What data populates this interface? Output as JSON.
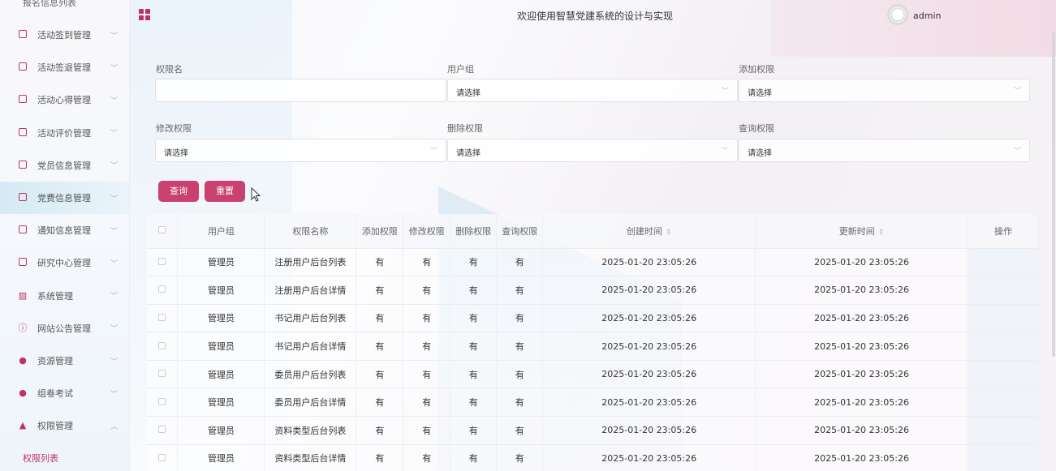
{
  "sidebar": {
    "top_label": "报名信息列表",
    "items": [
      {
        "label": "活动签到管理",
        "icon": "page-icon"
      },
      {
        "label": "活动签退管理",
        "icon": "page-icon"
      },
      {
        "label": "活动心得管理",
        "icon": "page-icon"
      },
      {
        "label": "活动评价管理",
        "icon": "page-icon"
      },
      {
        "label": "党员信息管理",
        "icon": "page-icon"
      },
      {
        "label": "党费信息管理",
        "icon": "page-icon"
      },
      {
        "label": "通知信息管理",
        "icon": "page-icon"
      },
      {
        "label": "研究中心管理",
        "icon": "page-icon"
      },
      {
        "label": "系统管理",
        "icon": "image-icon"
      },
      {
        "label": "网站公告管理",
        "icon": "info-icon"
      },
      {
        "label": "资源管理",
        "icon": "location-icon"
      },
      {
        "label": "组卷考试",
        "icon": "location-icon"
      },
      {
        "label": "权限管理",
        "icon": "user-icon"
      }
    ],
    "active_sub": "权限列表"
  },
  "header": {
    "title": "欢迎使用智慧党建系统的设计与实现",
    "username": "admin"
  },
  "form": {
    "perm_name_label": "权限名",
    "perm_name_value": "",
    "user_group_label": "用户组",
    "add_perm_label": "添加权限",
    "edit_perm_label": "修改权限",
    "delete_perm_label": "删除权限",
    "query_perm_label": "查询权限",
    "select_placeholder": "请选择",
    "search_button": "查询",
    "reset_button": "重置"
  },
  "table": {
    "headers": [
      "用户组",
      "权限名称",
      "添加权限",
      "修改权限",
      "删除权限",
      "查询权限",
      "创建时间",
      "更新时间",
      "操作"
    ],
    "rows": [
      [
        "管理员",
        "注册用户后台列表",
        "有",
        "有",
        "有",
        "有",
        "2025-01-20 23:05:26",
        "2025-01-20 23:05:26"
      ],
      [
        "管理员",
        "注册用户后台详情",
        "有",
        "有",
        "有",
        "有",
        "2025-01-20 23:05:26",
        "2025-01-20 23:05:26"
      ],
      [
        "管理员",
        "书记用户后台列表",
        "有",
        "有",
        "有",
        "有",
        "2025-01-20 23:05:26",
        "2025-01-20 23:05:26"
      ],
      [
        "管理员",
        "书记用户后台详情",
        "有",
        "有",
        "有",
        "有",
        "2025-01-20 23:05:26",
        "2025-01-20 23:05:26"
      ],
      [
        "管理员",
        "委员用户后台列表",
        "有",
        "有",
        "有",
        "有",
        "2025-01-20 23:05:26",
        "2025-01-20 23:05:26"
      ],
      [
        "管理员",
        "委员用户后台详情",
        "有",
        "有",
        "有",
        "有",
        "2025-01-20 23:05:26",
        "2025-01-20 23:05:26"
      ],
      [
        "管理员",
        "资料类型后台列表",
        "有",
        "有",
        "有",
        "有",
        "2025-01-20 23:05:26",
        "2025-01-20 23:05:26"
      ],
      [
        "管理员",
        "资料类型后台详情",
        "有",
        "有",
        "有",
        "有",
        "2025-01-20 23:05:26",
        "2025-01-20 23:05:26"
      ]
    ]
  },
  "colors": {
    "accent": "#c8416f"
  }
}
